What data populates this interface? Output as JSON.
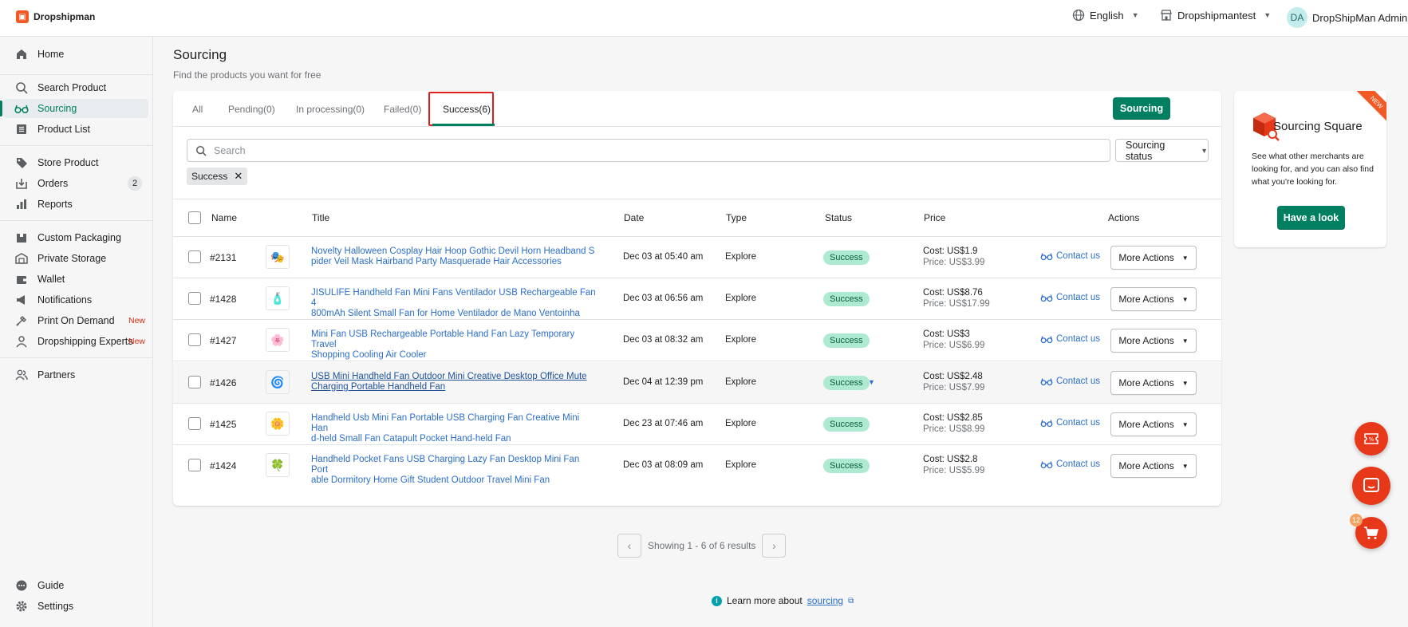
{
  "app": {
    "brand": "Dropshipman"
  },
  "topbar": {
    "language": "English",
    "store": "Dropshipmantest",
    "avatar_initials": "DA",
    "user": "DropShipMan Admin"
  },
  "sidebar": {
    "items": [
      {
        "label": "Home",
        "icon": "home-icon"
      },
      {
        "label": "Search Product",
        "icon": "search-icon"
      },
      {
        "label": "Sourcing",
        "icon": "glasses-icon"
      },
      {
        "label": "Product List",
        "icon": "list-icon"
      },
      {
        "label": "Store Product",
        "icon": "tag-icon"
      },
      {
        "label": "Orders",
        "icon": "orders-icon",
        "badge": "2"
      },
      {
        "label": "Reports",
        "icon": "bar-chart-icon"
      },
      {
        "label": "Custom Packaging",
        "icon": "package-icon"
      },
      {
        "label": "Private Storage",
        "icon": "warehouse-icon"
      },
      {
        "label": "Wallet",
        "icon": "wallet-icon"
      },
      {
        "label": "Notifications",
        "icon": "megaphone-icon"
      },
      {
        "label": "Print On Demand",
        "icon": "print-icon",
        "new": "New"
      },
      {
        "label": "Dropshipping Experts",
        "icon": "person-icon",
        "new": "New"
      },
      {
        "label": "Partners",
        "icon": "partners-icon"
      },
      {
        "label": "Guide",
        "icon": "chat-icon"
      },
      {
        "label": "Settings",
        "icon": "gear-icon"
      }
    ]
  },
  "page": {
    "title": "Sourcing",
    "subtitle": "Find the products you want for free"
  },
  "tabs": [
    "All",
    "Pending(0)",
    "In processing(0)",
    "Failed(0)",
    "Success(6)"
  ],
  "sourcing_button": "Sourcing",
  "search": {
    "placeholder": "Search"
  },
  "status_filter": "Sourcing status",
  "active_filter_chip": "Success",
  "table": {
    "headers": [
      "Name",
      "Title",
      "Date",
      "Type",
      "Status",
      "Price",
      "Actions"
    ],
    "cost_label": "Cost:",
    "price_label": "Price:",
    "contact_label": "Contact us",
    "more_actions_label": "More Actions",
    "rows": [
      {
        "name": "#2131",
        "title": "Novelty Halloween Cosplay Hair Hoop Gothic Devil Horn Headband Spider Veil Mask Hairband Party Masquerade Hair Accessories",
        "title_l1": "Novelty Halloween Cosplay Hair Hoop Gothic Devil Horn Headband S",
        "title_l2": "pider Veil Mask Hairband Party Masquerade Hair Accessories",
        "date": "Dec 03 at 05:40 am",
        "type": "Explore",
        "status": "Success",
        "cost": "US$1.9",
        "price": "US$3.99",
        "thumb": "🎭"
      },
      {
        "name": "#1428",
        "title": "JISULIFE Handheld Fan Mini Fans Ventilador USB Rechargeable Fan 4800mAh Silent Small Fan for Home Ventilador de Mano Ventoinha",
        "title_l1": "JISULIFE Handheld Fan Mini Fans Ventilador USB Rechargeable Fan 4",
        "title_l2": "800mAh Silent Small Fan for Home Ventilador de Mano Ventoinha",
        "date": "Dec 03 at 06:56 am",
        "type": "Explore",
        "status": "Success",
        "cost": "US$8.76",
        "price": "US$17.99",
        "thumb": "🧴"
      },
      {
        "name": "#1427",
        "title": "Mini Fan USB Rechargeable Portable Hand Fan Lazy Temporary Travel Shopping Cooling Air Cooler",
        "title_l1": "Mini Fan USB Rechargeable Portable Hand Fan Lazy Temporary Travel",
        "title_l2": "Shopping Cooling Air Cooler",
        "date": "Dec 03 at 08:32 am",
        "type": "Explore",
        "status": "Success",
        "cost": "US$3",
        "price": "US$6.99",
        "thumb": "🌸"
      },
      {
        "name": "#1426",
        "title": "USB Mini Handheld Fan Outdoor Mini Creative Desktop Office Mute Charging Portable Handheld Fan",
        "title_l1": "USB Mini Handheld Fan Outdoor Mini Creative Desktop Office Mute",
        "title_l2": "Charging Portable Handheld Fan",
        "date": "Dec 04 at 12:39 pm",
        "type": "Explore",
        "status": "Success",
        "cost": "US$2.48",
        "price": "US$7.99",
        "thumb": "🌀"
      },
      {
        "name": "#1425",
        "title": "Handheld Usb Mini Fan Portable USB Charging Fan Creative Mini Hand-held Small Fan Catapult Pocket Hand-held Fan",
        "title_l1": "Handheld Usb Mini Fan Portable USB Charging Fan Creative Mini Han",
        "title_l2": "d-held Small Fan Catapult Pocket Hand-held Fan",
        "date": "Dec 23 at 07:46 am",
        "type": "Explore",
        "status": "Success",
        "cost": "US$2.85",
        "price": "US$8.99",
        "thumb": "🌼"
      },
      {
        "name": "#1424",
        "title": "Handheld Pocket Fans USB Charging Lazy Fan Desktop Mini Fan Portable Dormitory Home Gift Student Outdoor Travel Mini Fan",
        "title_l1": "Handheld Pocket Fans USB Charging Lazy Fan Desktop Mini Fan Port",
        "title_l2": "able Dormitory Home Gift Student Outdoor Travel Mini Fan",
        "date": "Dec 03 at 08:09 am",
        "type": "Explore",
        "status": "Success",
        "cost": "US$2.8",
        "price": "US$5.99",
        "thumb": "🍀"
      }
    ]
  },
  "pagination": {
    "text": "Showing 1 - 6 of 6 results"
  },
  "learn_more": {
    "prefix": "Learn more about",
    "link": "sourcing"
  },
  "sourcing_square": {
    "title": "Sourcing Square",
    "description": "See what other merchants are looking for, and you can also find what you're looking for.",
    "button": "Have a look",
    "ribbon": "NEW"
  },
  "floating": {
    "cart_count": "12"
  },
  "colors": {
    "accent": "#008060",
    "link": "#2c6ecb",
    "danger": "#e8381a",
    "success_badge": "#aee9d1"
  }
}
